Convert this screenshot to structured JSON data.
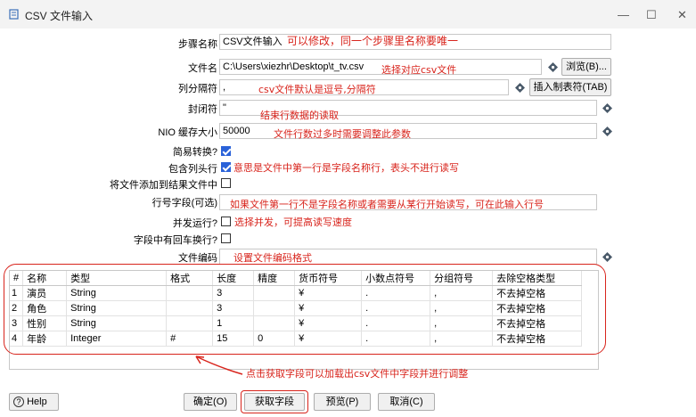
{
  "window": {
    "title": "CSV 文件输入",
    "minimize_icon": "minimize-icon",
    "maximize_icon": "maximize-icon",
    "close_icon": "close-icon"
  },
  "form": {
    "step_name_label": "步骤名称",
    "step_name_value": "CSV文件输入",
    "filename_label": "文件名",
    "filename_value": "C:\\Users\\xiezhr\\Desktop\\t_tv.csv",
    "browse_button": "浏览(B)...",
    "delimiter_label": "列分隔符",
    "delimiter_value": ",",
    "insert_tab_button": "插入制表符(TAB)",
    "enclosure_label": "封闭符",
    "enclosure_value": "\"",
    "nio_buffer_label": "NIO 缓存大小",
    "nio_buffer_value": "50000",
    "lazy_conversion_label": "简易转换?",
    "lazy_conversion_checked": true,
    "header_row_label": "包含列头行",
    "header_row_checked": true,
    "add_filename_label": "将文件添加到结果文件中",
    "add_filename_checked": false,
    "row_number_label": "行号字段(可选)",
    "row_number_value": "",
    "parallel_label": "并发运行?",
    "parallel_checked": false,
    "newline_fields_label": "字段中有回车换行?",
    "newline_fields_checked": false,
    "encoding_label": "文件编码",
    "encoding_value": ""
  },
  "annotations": {
    "step_name": "可以修改，同一个步骤里名称要唯一",
    "filename": "选择对应csv文件",
    "delimiter": "csv文件默认是逗号,分隔符",
    "enclosure": "结束行数据的读取",
    "nio_buffer": "文件行数过多时需要调整此参数",
    "header_row": "意思是文件中第一行是字段名称行，表头不进行读写",
    "row_number": "如果文件第一行不是字段名称或者需要从某行开始读写，可在此输入行号",
    "parallel": "选择并发，可提高读写速度",
    "encoding": "设置文件编码格式",
    "get_fields": "点击获取字段可以加载出csv文件中字段并进行调整"
  },
  "table": {
    "columns": [
      "#",
      "名称",
      "类型",
      "格式",
      "长度",
      "精度",
      "货币符号",
      "小数点符号",
      "分组符号",
      "去除空格类型"
    ],
    "rows": [
      [
        "1",
        "演员",
        "String",
        "",
        "3",
        "",
        "¥",
        ".",
        ",",
        "不去掉空格"
      ],
      [
        "2",
        "角色",
        "String",
        "",
        "3",
        "",
        "¥",
        ".",
        ",",
        "不去掉空格"
      ],
      [
        "3",
        "性别",
        "String",
        "",
        "1",
        "",
        "¥",
        ".",
        ",",
        "不去掉空格"
      ],
      [
        "4",
        "年龄",
        "Integer",
        "#",
        "15",
        "0",
        "¥",
        ".",
        ",",
        "不去掉空格"
      ]
    ]
  },
  "buttons": {
    "help": "Help",
    "ok": "确定(O)",
    "get_fields": "获取字段",
    "preview": "预览(P)",
    "cancel": "取消(C)"
  },
  "colors": {
    "annotation": "#d8241c",
    "help_icon": "#4a5a6a",
    "checkbox_checked": "#2a62d9"
  }
}
